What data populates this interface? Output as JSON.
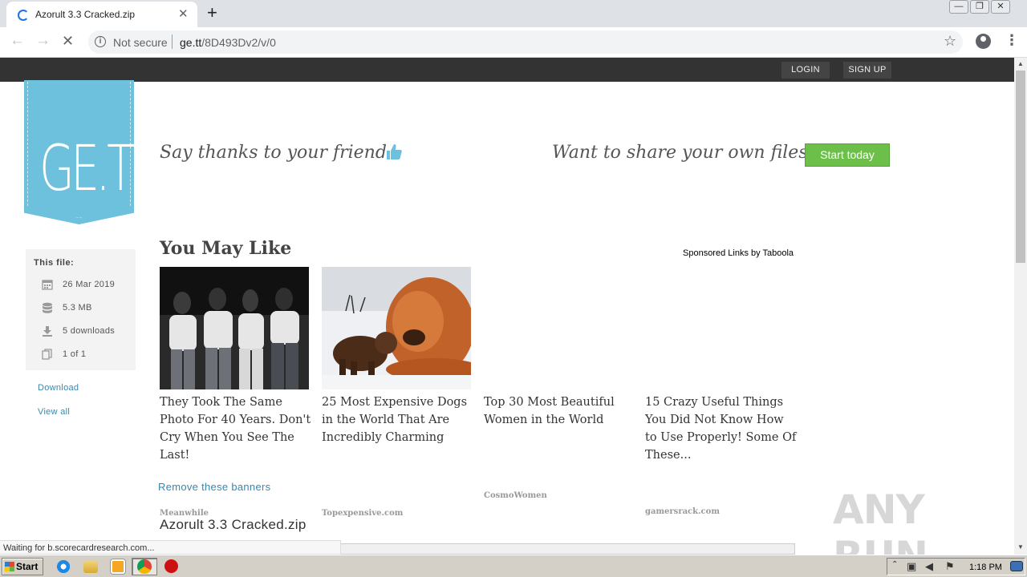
{
  "browser": {
    "tab_title": "Azorult 3.3 Cracked.zip",
    "tab_close": "✕",
    "new_tab": "+",
    "security_label": "Not secure",
    "url_host": "ge.tt",
    "url_path": "/8D493Dv2/v/0",
    "window_buttons": [
      "—",
      "❐",
      "✕"
    ]
  },
  "header": {
    "login_label": "LOGIN",
    "signup_label": "SIGN UP"
  },
  "logo": {
    "text": "GE.TT",
    "color": "#6ec1dc"
  },
  "promo": {
    "thanks_text": "Say thanks to your friend",
    "share_text": "Want to share your own files?",
    "start_label": "Start today",
    "start_color": "#6cc04a"
  },
  "file_info": {
    "heading": "This file:",
    "date": "26 Mar 2019",
    "size": "5.3 MB",
    "downloads": "5 downloads",
    "count": "1 of 1",
    "download_link": "Download",
    "view_all_link": "View all"
  },
  "recommendations": {
    "heading": "You May Like",
    "sponsored": "Sponsored Links by Taboola",
    "cards": [
      {
        "title": "They Took The Same Photo For 40 Years. Don't Cry When You See The Last!",
        "source": "Meanwhile"
      },
      {
        "title": "25 Most Expensive Dogs in the World That Are Incredibly Charming",
        "source": "Topexpensive.com"
      },
      {
        "title": "Top 30 Most Beautiful Women in the World",
        "source": "CosmoWomen"
      },
      {
        "title": "15 Crazy Useful Things You Did Not Know How to Use Properly! Some Of These...",
        "source": "gamersrack.com"
      }
    ],
    "remove_link": "Remove these banners"
  },
  "file_name": "Azorult 3.3 Cracked.zip",
  "watermark": "ANY RUN",
  "status_text": "Waiting for b.scorecardresearch.com...",
  "taskbar": {
    "start_label": "Start",
    "clock": "1:18 PM"
  }
}
